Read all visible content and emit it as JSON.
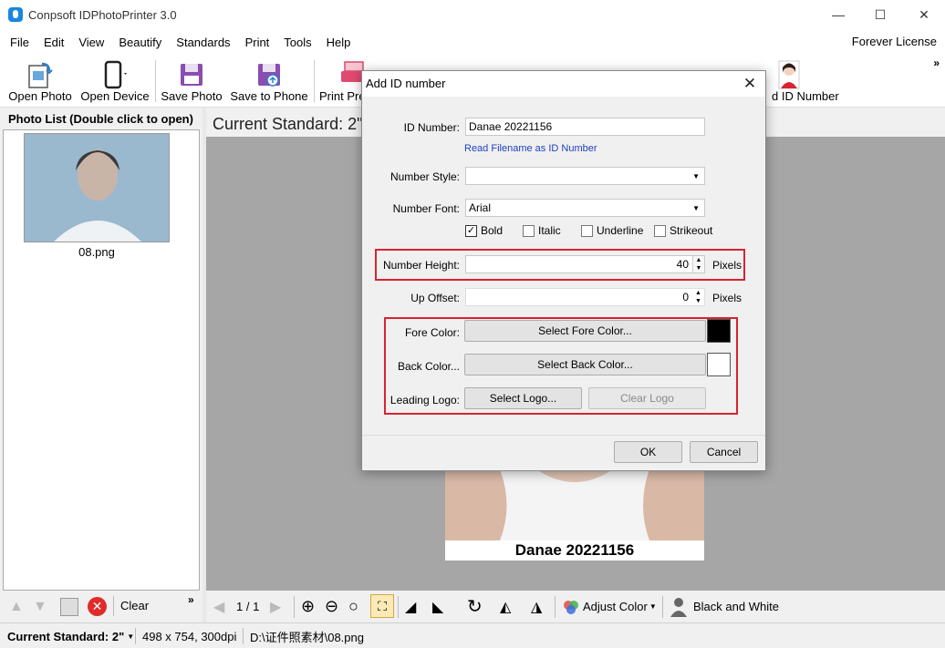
{
  "window": {
    "title": "Conpsoft IDPhotoPrinter 3.0",
    "minimize": "—",
    "maximize": "☐",
    "close": "✕"
  },
  "menu": {
    "items": [
      "File",
      "Edit",
      "View",
      "Beautify",
      "Standards",
      "Print",
      "Tools",
      "Help"
    ],
    "license": "Forever License"
  },
  "toolbar": {
    "open_photo": "Open Photo",
    "open_device": "Open Device",
    "save_photo": "Save Photo",
    "save_to_phone": "Save to Phone",
    "print_preview_partial": "Print Pre",
    "id_number_partial": "d ID Number",
    "overflow": "»"
  },
  "left_panel": {
    "heading": "Photo List (Double click to open)",
    "photo_name": "08.png",
    "clear_label": "Clear",
    "overflow": "»"
  },
  "center": {
    "standard_heading": "Current Standard: 2\"",
    "photo_caption": "Danae 20221156"
  },
  "bottom_bar": {
    "page": "1 / 1",
    "adjust_color": "Adjust Color",
    "black_white": "Black and White"
  },
  "status_bar": {
    "standard": "Current Standard: 2\"",
    "dims": "498 x 754, 300dpi",
    "path": "D:\\证件照素材\\08.png"
  },
  "dialog": {
    "title": "Add ID number",
    "id_number_label": "ID Number:",
    "id_number_value": "Danae 20221156",
    "read_filename_link": "Read Filename as ID Number",
    "number_style_label": "Number Style:",
    "number_style_value": "",
    "number_font_label": "Number Font:",
    "number_font_value": "Arial",
    "bold_label": "Bold",
    "bold_checked": true,
    "italic_label": "Italic",
    "italic_checked": false,
    "underline_label": "Underline",
    "underline_checked": false,
    "strikeout_label": "Strikeout",
    "strikeout_checked": false,
    "number_height_label": "Number Height:",
    "number_height_value": "40",
    "number_height_unit": "Pixels",
    "up_offset_label": "Up Offset:",
    "up_offset_value": "0",
    "up_offset_unit": "Pixels",
    "fore_color_label": "Fore Color:",
    "fore_color_button": "Select Fore Color...",
    "fore_color": "#000000",
    "back_color_label": "Back Color...",
    "back_color_button": "Select Back Color...",
    "back_color": "#ffffff",
    "leading_logo_label": "Leading Logo:",
    "select_logo_button": "Select Logo...",
    "clear_logo_button": "Clear Logo",
    "ok_button": "OK",
    "cancel_button": "Cancel"
  },
  "colors": {
    "highlight": "#d9232f",
    "link": "#1f3fbf",
    "canvas_bg": "#a6a6a6"
  }
}
